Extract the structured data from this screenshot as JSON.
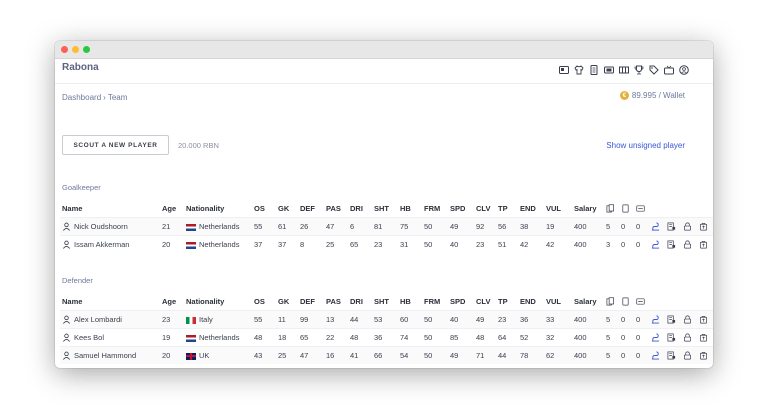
{
  "app": {
    "brand": "Rabona"
  },
  "nav_icons": [
    "card-icon",
    "jersey-icon",
    "document-icon",
    "ticket-icon",
    "film-icon",
    "trophy-icon",
    "tag-icon",
    "tv-icon",
    "account-icon"
  ],
  "breadcrumb": {
    "items": [
      "Dashboard",
      "Team"
    ],
    "separator": "›"
  },
  "wallet": {
    "coin_symbol": "€",
    "text": "89.995 / Wallet"
  },
  "scout": {
    "button_label": "SCOUT A NEW PLAYER",
    "price": "20.000 RBN"
  },
  "show_unsigned_label": "Show unsigned player",
  "columns": [
    "Name",
    "Age",
    "Nationality",
    "OS",
    "GK",
    "DEF",
    "PAS",
    "DRI",
    "SHT",
    "HB",
    "FRM",
    "SPD",
    "CLV",
    "TP",
    "END",
    "VUL",
    "Salary"
  ],
  "column_icons": [
    "cards-stack-icon",
    "card-outline-icon",
    "card-swap-icon"
  ],
  "sections": [
    {
      "title": "Goalkeeper",
      "players": [
        {
          "name": "Nick Oudshoorn",
          "age": "21",
          "flag": "nl",
          "nationality": "Netherlands",
          "os": "55",
          "gk": "61",
          "def": "26",
          "pas": "47",
          "dri": "6",
          "sht": "81",
          "hb": "75",
          "frm": "50",
          "spd": "49",
          "clv": "92",
          "tp": "56",
          "end": "38",
          "vul": "19",
          "salary": "400",
          "c1": "5",
          "c2": "0",
          "c3": "0"
        },
        {
          "name": "Issam Akkerman",
          "age": "20",
          "flag": "nl",
          "nationality": "Netherlands",
          "os": "37",
          "gk": "37",
          "def": "8",
          "pas": "25",
          "dri": "65",
          "sht": "23",
          "hb": "31",
          "frm": "50",
          "spd": "40",
          "clv": "23",
          "tp": "51",
          "end": "42",
          "vul": "42",
          "salary": "400",
          "c1": "3",
          "c2": "0",
          "c3": "0"
        }
      ]
    },
    {
      "title": "Defender",
      "players": [
        {
          "name": "Alex Lombardi",
          "age": "23",
          "flag": "it",
          "nationality": "Italy",
          "os": "55",
          "gk": "11",
          "def": "99",
          "pas": "13",
          "dri": "44",
          "sht": "53",
          "hb": "60",
          "frm": "50",
          "spd": "40",
          "clv": "49",
          "tp": "23",
          "end": "36",
          "vul": "33",
          "salary": "400",
          "c1": "5",
          "c2": "0",
          "c3": "0"
        },
        {
          "name": "Kees Bol",
          "age": "19",
          "flag": "nl",
          "nationality": "Netherlands",
          "os": "48",
          "gk": "18",
          "def": "65",
          "pas": "22",
          "dri": "48",
          "sht": "36",
          "hb": "74",
          "frm": "50",
          "spd": "85",
          "clv": "48",
          "tp": "64",
          "end": "52",
          "vul": "32",
          "salary": "400",
          "c1": "5",
          "c2": "0",
          "c3": "0"
        },
        {
          "name": "Samuel Hammond",
          "age": "20",
          "flag": "uk",
          "nationality": "UK",
          "os": "43",
          "gk": "25",
          "def": "47",
          "pas": "16",
          "dri": "41",
          "sht": "66",
          "hb": "54",
          "frm": "50",
          "spd": "49",
          "clv": "71",
          "tp": "44",
          "end": "78",
          "vul": "62",
          "salary": "400",
          "c1": "5",
          "c2": "0",
          "c3": "0"
        }
      ]
    }
  ],
  "row_actions": [
    "train-icon",
    "contract-icon",
    "lock-icon",
    "sell-icon"
  ],
  "colors": {
    "accent_blue": "#3a57d6",
    "os_green": "#3fa34d",
    "muted_text": "#6d7a9c"
  }
}
